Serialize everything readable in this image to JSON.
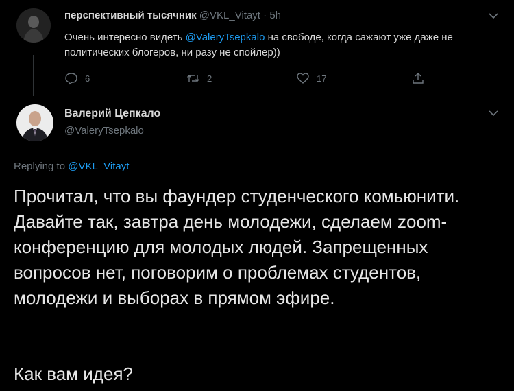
{
  "tweet1": {
    "author_name": "перспективный тысячник",
    "handle": "@VKL_Vitayt",
    "separator": "·",
    "time": "5h",
    "text_pre": "Очень интересно видеть ",
    "mention": "@ValeryTsepkalo",
    "text_post": " на свободе, когда сажают уже даже не политических блогеров, ни разу не спойлер))",
    "reply_count": "6",
    "retweet_count": "2",
    "like_count": "17",
    "icons": {
      "reply": "reply-icon",
      "retweet": "retweet-icon",
      "like": "heart-icon",
      "share": "share-icon",
      "more": "chevron-down-icon"
    }
  },
  "tweet2": {
    "author_name": "Валерий Цепкало",
    "handle": "@ValeryTsepkalo",
    "replying_prefix": "Replying to ",
    "replying_handle": "@VKL_Vitayt",
    "paragraph1": "Прочитал, что вы фаундер студенческого комьюнити. Давайте так, завтра день молодежи, сделаем zoom-конференцию для молодых людей. Запрещенных вопросов нет, поговорим о проблемах студентов, молодежи и выборах в прямом эфире.",
    "paragraph2": "Как вам идея?"
  },
  "colors": {
    "background": "#000000",
    "link": "#1d9bf0",
    "muted": "#6e767d",
    "text": "#d9d9d9"
  }
}
